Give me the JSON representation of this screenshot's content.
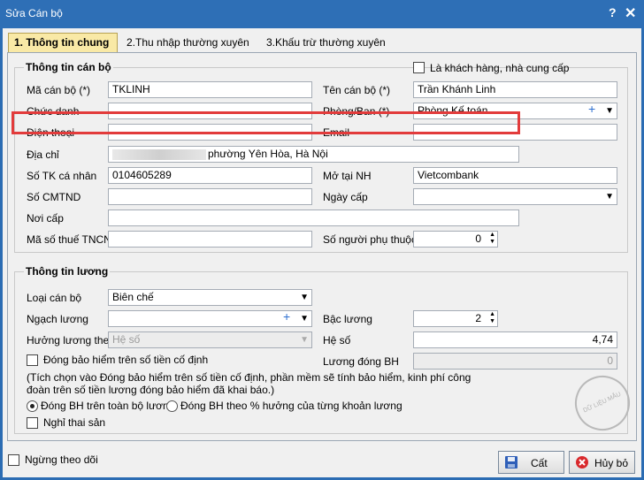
{
  "window": {
    "title": "Sửa Cán bộ",
    "help": "?",
    "close": "✕"
  },
  "tabs": [
    "1. Thông tin chung",
    "2.Thu nhập thường xuyên",
    "3.Khấu trừ thường xuyên"
  ],
  "canbo": {
    "group_title": "Thông tin cán bộ",
    "is_customer_label": "Là khách hàng, nhà cung cấp",
    "ma_can_bo": {
      "label": "Mã cán bộ (*)",
      "value": "TKLINH"
    },
    "ten_can_bo": {
      "label": "Tên cán bộ (*)",
      "value": "Trần Khánh Linh"
    },
    "chuc_danh": {
      "label": "Chức danh",
      "value": ""
    },
    "phong_ban": {
      "label": "Phòng/Ban (*)",
      "value": "Phòng Kế toán"
    },
    "dien_thoai": {
      "label": "Điện thoại",
      "value": ""
    },
    "email": {
      "label": "Email",
      "value": ""
    },
    "dia_chi": {
      "label": "Địa chỉ",
      "value": "phường Yên Hòa, Hà Nội"
    },
    "so_tk": {
      "label": "Số TK cá nhân",
      "value": "0104605289"
    },
    "mo_tai": {
      "label": "Mở tại NH",
      "value": "Vietcombank"
    },
    "so_cmtnd": {
      "label": "Số CMTND",
      "value": ""
    },
    "ngay_cap": {
      "label": "Ngày cấp",
      "value": ""
    },
    "noi_cap": {
      "label": "Nơi cấp",
      "value": ""
    },
    "ma_so_thue": {
      "label": "Mã số thuế TNCN",
      "value": ""
    },
    "so_nguoi_phu_thuoc": {
      "label": "Số người phụ thuộc",
      "value": "0"
    }
  },
  "luong": {
    "group_title": "Thông tin lương",
    "loai_can_bo": {
      "label": "Loại cán bộ",
      "value": "Biên chế"
    },
    "ngach_luong": {
      "label": "Ngạch lương",
      "value": ""
    },
    "bac_luong": {
      "label": "Bậc lương",
      "value": "2"
    },
    "huong_luong_theo": {
      "label": "Hưởng lương theo",
      "value": "Hệ số"
    },
    "he_so": {
      "label": "Hệ số",
      "value": "4,74"
    },
    "dong_bh_co_dinh": "Đóng bảo hiểm trên số tiền cố định",
    "luong_dong_bh": {
      "label": "Lương đóng BH",
      "value": "0"
    },
    "note_line1": "(Tích chọn vào Đóng bảo hiểm trên số tiền cố định, phần mềm sẽ tính bảo hiểm, kinh phí công",
    "note_line2": "đoàn trên số tiền lương đóng bảo hiểm đã khai báo.)",
    "radio_toan_bo": "Đóng BH trên toàn bộ lương",
    "radio_theo_pct": "Đóng BH theo % hưởng của từng khoản lương",
    "nghi_thai_san": "Nghỉ thai sản"
  },
  "footer": {
    "ngung_theo_doi": "Ngừng theo dõi",
    "save": "Cất",
    "cancel": "Hủy bỏ"
  },
  "watermark": "DỮ LIỆU MẪU"
}
